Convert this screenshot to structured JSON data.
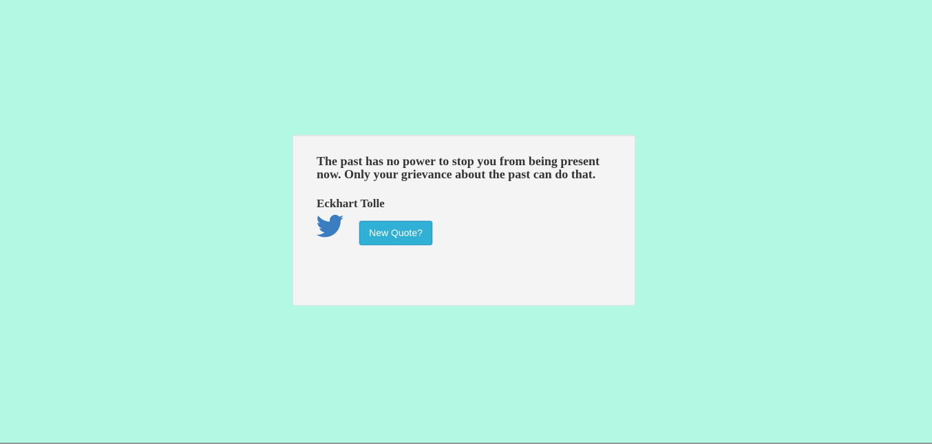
{
  "quote": {
    "text": "The past has no power to stop you from being present now. Only your grievance about the past can do that.",
    "author": "Eckhart Tolle"
  },
  "tweet": {
    "icon": "twitter-bird-icon",
    "color": "#3a7ec1"
  },
  "new_quote_button": {
    "label": "New Quote?",
    "color": "#31b0d5"
  },
  "colors": {
    "page_background": "#b3f8e3",
    "card_background": "#f4f4f4",
    "text": "#333333"
  }
}
